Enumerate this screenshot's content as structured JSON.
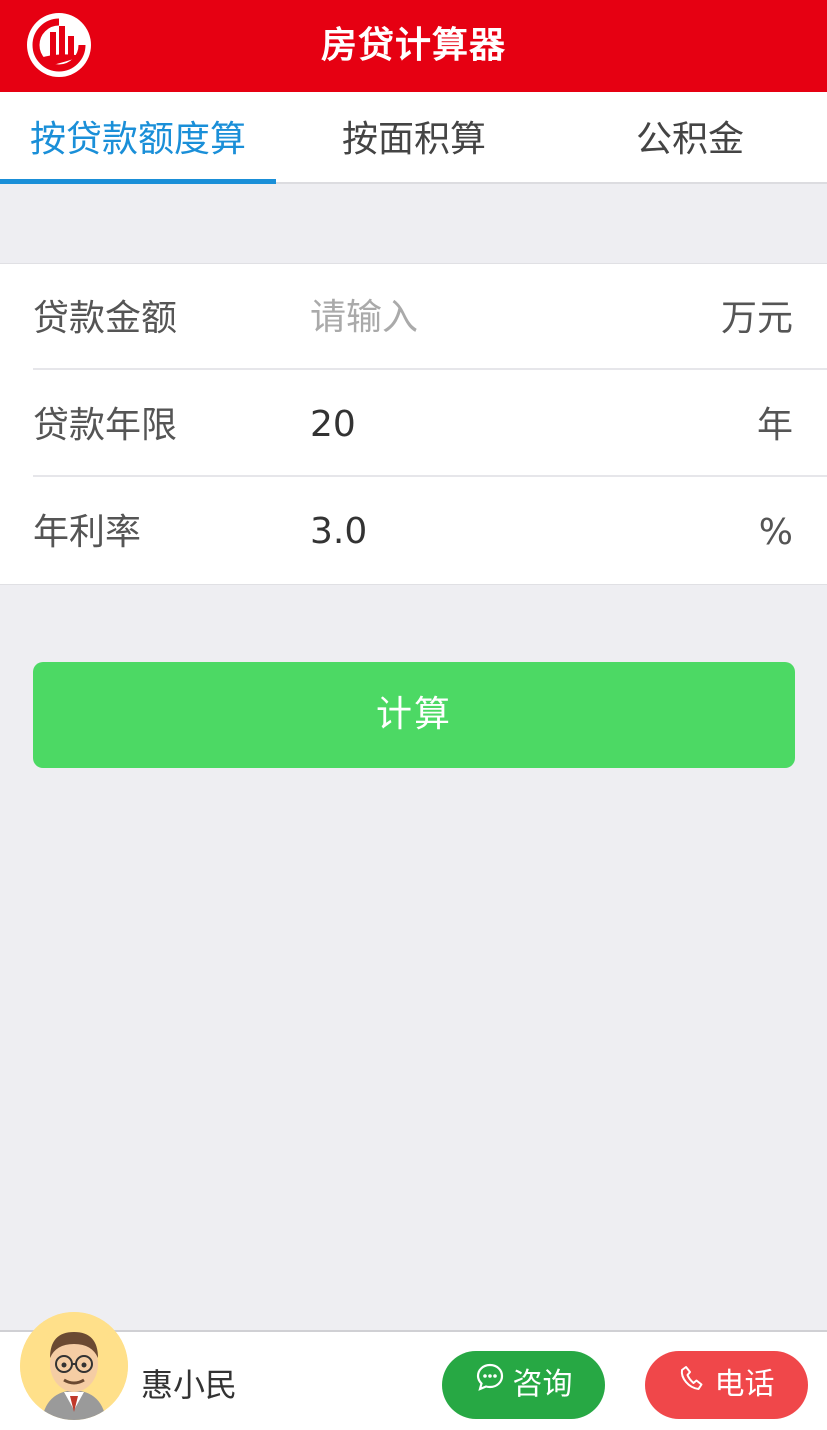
{
  "header": {
    "title": "房贷计算器",
    "logo_icon": "building-logo-icon",
    "brand_color": "#e60012"
  },
  "tabs": [
    {
      "label": "按贷款额度算",
      "active": true
    },
    {
      "label": "按面积算",
      "active": false
    },
    {
      "label": "公积金",
      "active": false
    }
  ],
  "form": {
    "loan_amount": {
      "label": "贷款金额",
      "placeholder": "请输入",
      "value": "",
      "unit": "万元"
    },
    "loan_term": {
      "label": "贷款年限",
      "value": "20",
      "unit": "年"
    },
    "interest_rate": {
      "label": "年利率",
      "value": "3.0",
      "unit": "%"
    }
  },
  "actions": {
    "calculate_label": "计算",
    "calculate_color": "#4cd964"
  },
  "footer": {
    "agent_name": "惠小民",
    "consult_label": "咨询",
    "consult_icon": "chat-bubble-icon",
    "consult_color": "#27a844",
    "phone_label": "电话",
    "phone_icon": "phone-icon",
    "phone_color": "#f0474a"
  },
  "accent_color": "#1a8fd8"
}
